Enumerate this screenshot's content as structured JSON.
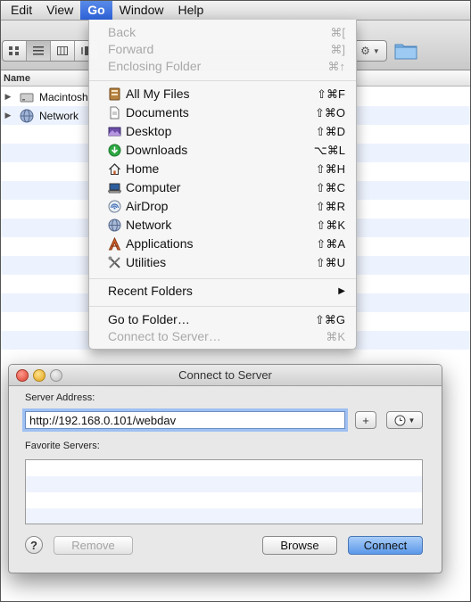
{
  "menubar": {
    "items": [
      {
        "label": "Edit"
      },
      {
        "label": "View"
      },
      {
        "label": "Go"
      },
      {
        "label": "Window"
      },
      {
        "label": "Help"
      }
    ]
  },
  "finder": {
    "column_header": "Name",
    "items": [
      {
        "label": "Macintosh",
        "icon": "hard-drive-icon"
      },
      {
        "label": "Network",
        "icon": "network-globe-icon"
      }
    ]
  },
  "go_menu": {
    "history": [
      {
        "label": "Back",
        "shortcut": "⌘[",
        "disabled": true
      },
      {
        "label": "Forward",
        "shortcut": "⌘]",
        "disabled": true
      },
      {
        "label": "Enclosing Folder",
        "shortcut": "⌘↑",
        "disabled": true
      }
    ],
    "places": [
      {
        "label": "All My Files",
        "shortcut": "⇧⌘F",
        "icon": "all-my-files-icon"
      },
      {
        "label": "Documents",
        "shortcut": "⇧⌘O",
        "icon": "documents-icon"
      },
      {
        "label": "Desktop",
        "shortcut": "⇧⌘D",
        "icon": "desktop-icon"
      },
      {
        "label": "Downloads",
        "shortcut": "⌥⌘L",
        "icon": "downloads-icon"
      },
      {
        "label": "Home",
        "shortcut": "⇧⌘H",
        "icon": "home-icon"
      },
      {
        "label": "Computer",
        "shortcut": "⇧⌘C",
        "icon": "computer-icon"
      },
      {
        "label": "AirDrop",
        "shortcut": "⇧⌘R",
        "icon": "airdrop-icon"
      },
      {
        "label": "Network",
        "shortcut": "⇧⌘K",
        "icon": "network-icon"
      },
      {
        "label": "Applications",
        "shortcut": "⇧⌘A",
        "icon": "applications-icon"
      },
      {
        "label": "Utilities",
        "shortcut": "⇧⌘U",
        "icon": "utilities-icon"
      }
    ],
    "recent_folders": {
      "label": "Recent Folders",
      "arrow": "▶"
    },
    "go_to_folder": {
      "label": "Go to Folder…",
      "shortcut": "⇧⌘G"
    },
    "connect_to_server": {
      "label": "Connect to Server…",
      "shortcut": "⌘K",
      "disabled": true
    }
  },
  "dialog": {
    "title": "Connect to Server",
    "server_address_label": "Server Address:",
    "server_address_value": "http://192.168.0.101/webdav",
    "add_button": "+",
    "favorite_servers_label": "Favorite Servers:",
    "help_button": "?",
    "remove_button": "Remove",
    "browse_button": "Browse",
    "connect_button": "Connect"
  },
  "colors": {
    "menu_highlight": "#2e62d9",
    "default_button": "#5b98ea",
    "focus_ring": "#9ec0f2"
  }
}
